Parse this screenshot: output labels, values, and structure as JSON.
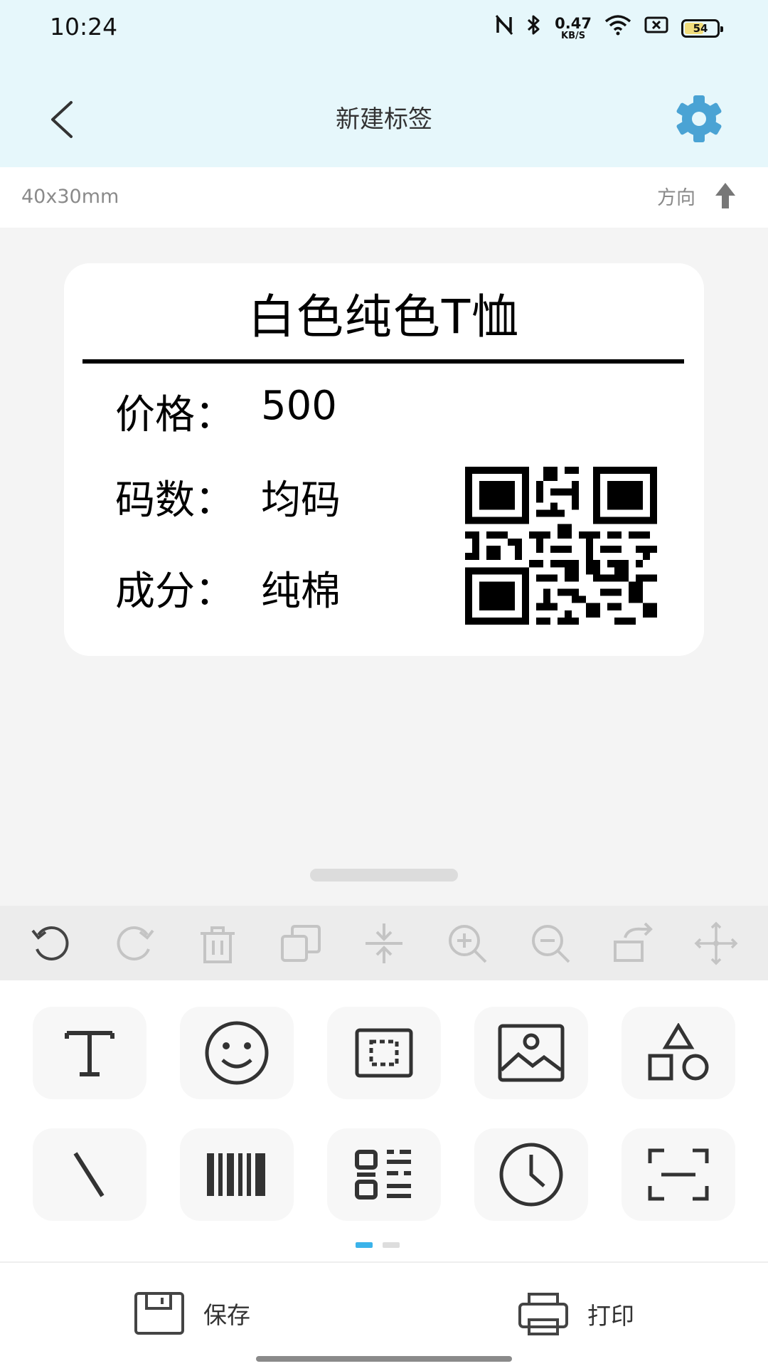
{
  "status_bar": {
    "time": "10:24",
    "net_speed_value": "0.47",
    "net_speed_unit": "KB/S",
    "battery_level": "54",
    "icons": [
      "nfc-icon",
      "bluetooth-icon",
      "wifi-icon",
      "sim-off-icon",
      "battery-icon"
    ]
  },
  "header": {
    "title": "新建标签",
    "back_icon": "chevron-left-icon",
    "settings_icon": "gear-icon",
    "accent_color": "#4aa3d4"
  },
  "label_info": {
    "size": "40x30mm",
    "direction_label": "方向",
    "direction_icon": "arrow-up-icon"
  },
  "label": {
    "title": "白色纯色T恤",
    "fields": [
      {
        "key": "价格：",
        "value": "500"
      },
      {
        "key": "码数：",
        "value": "均码"
      },
      {
        "key": "成分：",
        "value": "纯棉"
      }
    ],
    "qr_icon": "qr-code"
  },
  "toolbar": {
    "tools": [
      "undo-icon",
      "redo-icon",
      "delete-icon",
      "copy-icon",
      "align-center-icon",
      "zoom-in-icon",
      "zoom-out-icon",
      "rotate-icon",
      "move-icon"
    ]
  },
  "insert_panel": {
    "row1": [
      "text-icon",
      "emoji-icon",
      "frame-icon",
      "image-icon",
      "shapes-icon"
    ],
    "row2": [
      "line-icon",
      "barcode-icon",
      "qrcode-icon",
      "clock-icon",
      "scan-icon"
    ],
    "page_count": 2,
    "active_page": 1
  },
  "bottom_bar": {
    "save_label": "保存",
    "print_label": "打印"
  }
}
